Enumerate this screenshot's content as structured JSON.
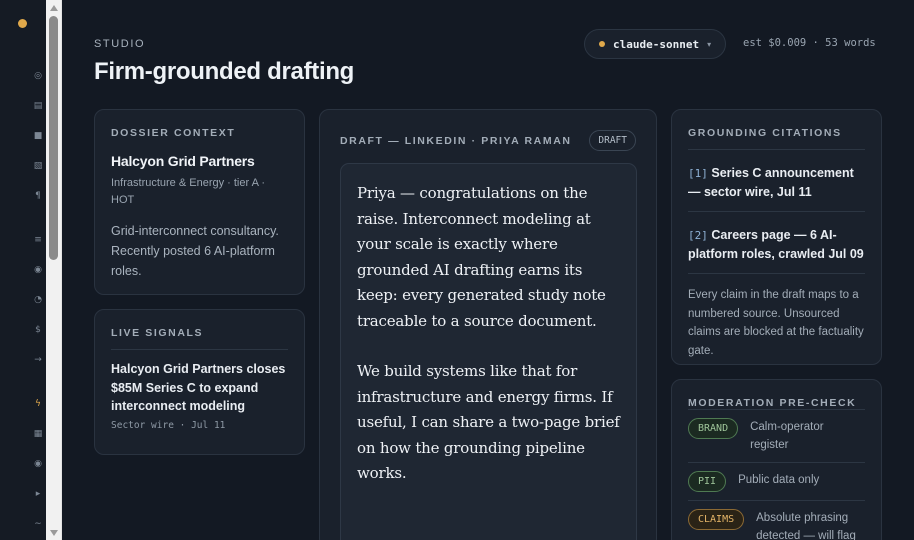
{
  "rail": {
    "icons": [
      "target-icon",
      "list-icon",
      "square-icon",
      "image-icon",
      "paragraph-icon",
      "menu-icon",
      "radio-icon",
      "clock-icon",
      "dollar-icon",
      "arrow-icon",
      "bolt-icon",
      "grid-icon",
      "record-icon",
      "play-icon",
      "wave-icon"
    ],
    "accent": "#e0a94b"
  },
  "header": {
    "eyebrow": "STUDIO",
    "title": "Firm-grounded drafting",
    "model": "claude-sonnet",
    "cost": "est $0.009 · 53 words"
  },
  "dossier": {
    "label": "DOSSIER CONTEXT",
    "company": "Halcyon Grid Partners",
    "meta": "Infrastructure & Energy · tier A · HOT",
    "note": "Grid-interconnect consultancy. Recently posted 6 AI-platform roles."
  },
  "signals": {
    "label": "LIVE SIGNALS",
    "headline": "Halcyon Grid Partners closes $85M Series C to expand interconnect modeling",
    "source": "Sector wire · Jul 11"
  },
  "draft": {
    "label": "DRAFT — LINKEDIN · PRIYA RAMAN",
    "badge": "DRAFT",
    "paragraphs": [
      "Priya — congratulations on the raise. Interconnect modeling at your scale is exactly where grounded AI drafting earns its keep: every generated study note traceable to a source document.",
      "We build systems like that for infrastructure and energy firms. If useful, I can share a two-page brief on how the grounding pipeline works."
    ]
  },
  "citations": {
    "label": "GROUNDING CITATIONS",
    "items": [
      {
        "num": "[1]",
        "text": "Series C announcement — sector wire, Jul 11"
      },
      {
        "num": "[2]",
        "text": "Careers page — 6 AI-platform roles, crawled Jul 09"
      }
    ],
    "explain": "Every claim in the draft maps to a numbered source. Unsourced claims are blocked at the factuality gate."
  },
  "moderation": {
    "label": "MODERATION PRE-CHECK",
    "items": [
      {
        "tag": "BRAND",
        "status": "ok",
        "text": "Calm-operator register"
      },
      {
        "tag": "PII",
        "status": "ok",
        "text": "Public data only"
      },
      {
        "tag": "CLAIMS",
        "status": "warn",
        "text": "Absolute phrasing detected — will flag"
      }
    ]
  }
}
